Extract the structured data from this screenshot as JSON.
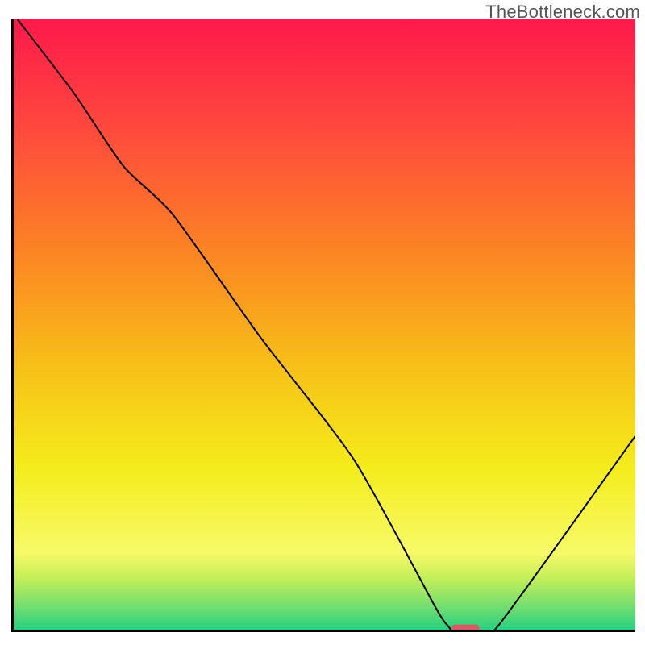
{
  "watermark": "TheBottleneck.com",
  "chart_data": {
    "type": "line",
    "title": "",
    "xlabel": "",
    "ylabel": "",
    "xlim": [
      0,
      100
    ],
    "ylim": [
      0,
      100
    ],
    "gradient_stops": [
      {
        "offset": 0.0,
        "color": "#ff184c"
      },
      {
        "offset": 0.2,
        "color": "#ff4f3b"
      },
      {
        "offset": 0.37,
        "color": "#fc8125"
      },
      {
        "offset": 0.56,
        "color": "#f7be18"
      },
      {
        "offset": 0.73,
        "color": "#f4ec1b"
      },
      {
        "offset": 0.87,
        "color": "#f7fa68"
      },
      {
        "offset": 0.91,
        "color": "#c7ef59"
      },
      {
        "offset": 0.955,
        "color": "#7adf6e"
      },
      {
        "offset": 1.0,
        "color": "#1fcf83"
      }
    ],
    "axis_color": "#000000",
    "axis_width": 3,
    "curve_color": "#000000",
    "curve_width": 2,
    "series": [
      {
        "name": "curve",
        "x": [
          1.0,
          10.0,
          18.0,
          26.0,
          40.0,
          55.0,
          68.0,
          70.0,
          71.0,
          74.5,
          78.0,
          100.0
        ],
        "y": [
          100.0,
          88.0,
          76.0,
          68.0,
          48.0,
          28.0,
          4.0,
          1.0,
          0.0,
          0.0,
          1.0,
          32.0
        ]
      }
    ],
    "marker": {
      "x_center": 72.8,
      "y": 0.0,
      "width": 4.4,
      "height": 1.4,
      "color": "#d85a62",
      "rx": 4
    }
  }
}
